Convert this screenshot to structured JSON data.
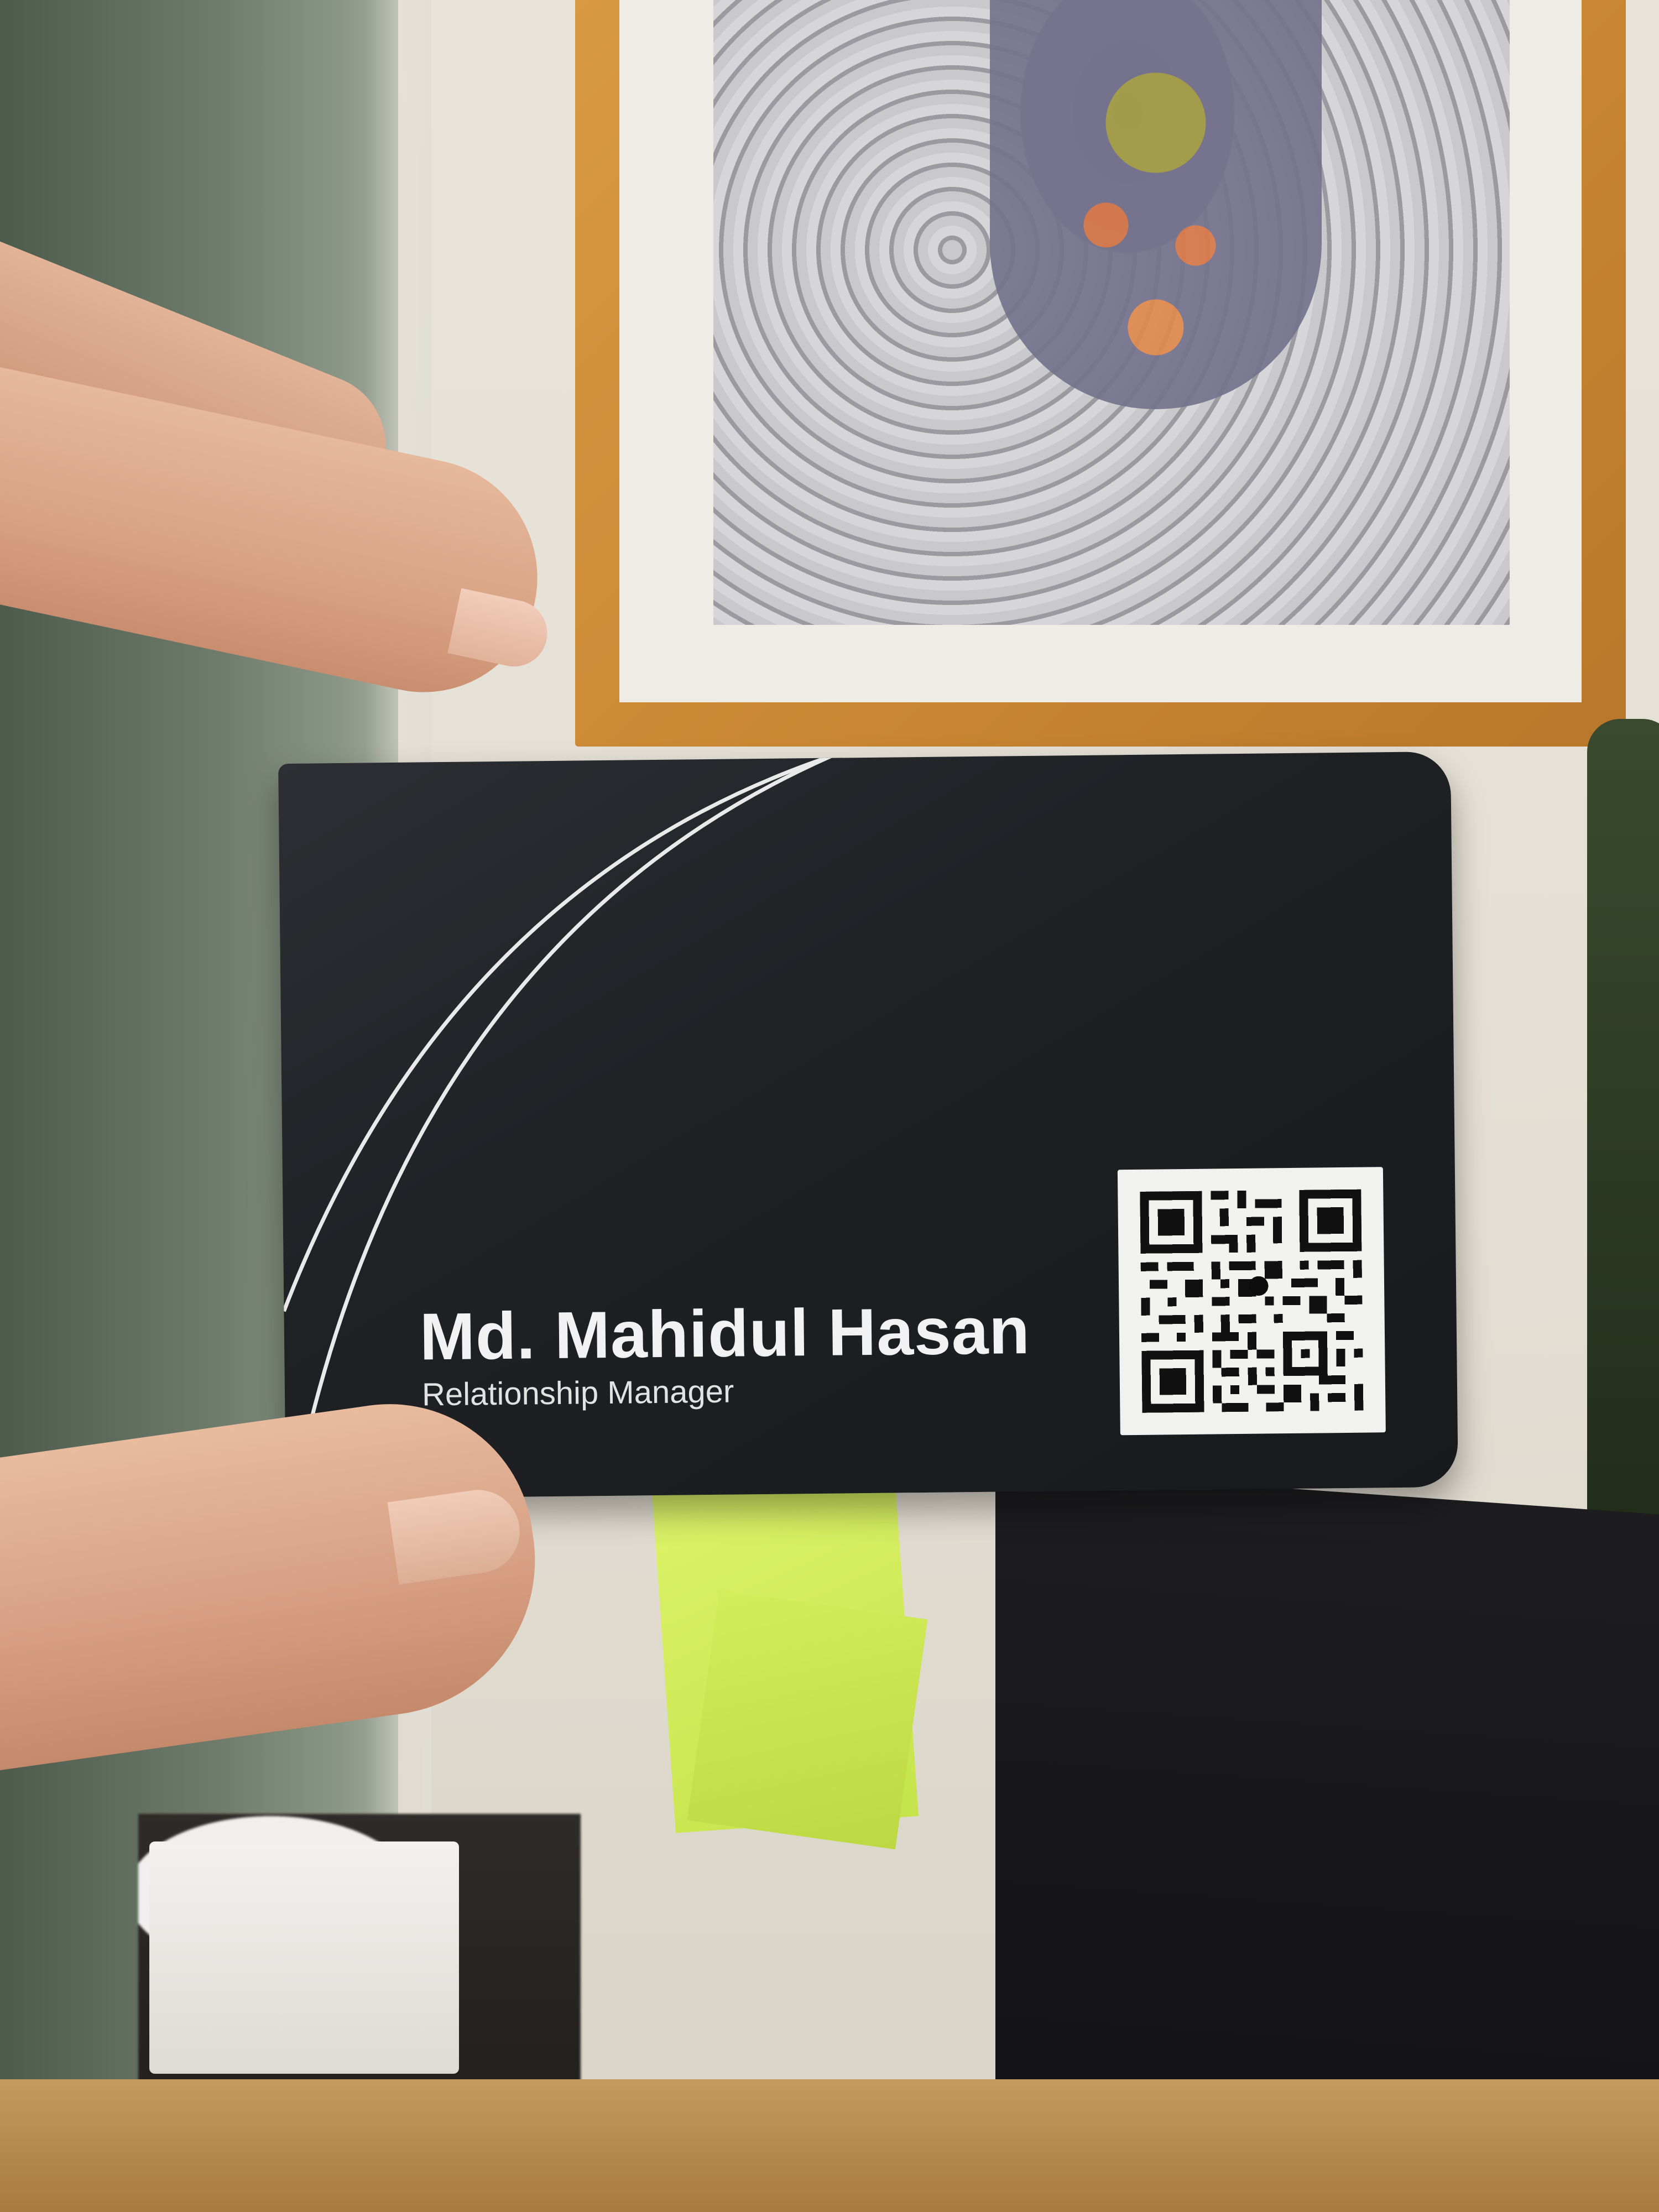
{
  "card": {
    "name": "Md. Mahidul Hasan",
    "title": "Relationship Manager"
  },
  "colors": {
    "card_background": "#1f2125",
    "card_text": "#f2f2f2",
    "qr_background": "#f1f1ef",
    "sticky_note": "#d3ee5a",
    "frame": "#c98531"
  },
  "icons": {
    "qr_code": "qr-code-icon"
  }
}
